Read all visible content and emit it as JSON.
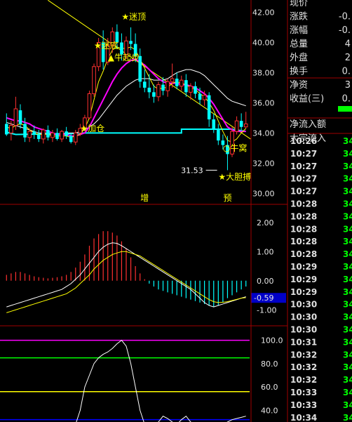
{
  "chart_data": [
    {
      "type": "candlestick",
      "title": "",
      "ylim": [
        29.5,
        43
      ],
      "yticks": [
        "42.00",
        "40.00",
        "38.00",
        "36.00",
        "34.00",
        "32.00",
        "30.00"
      ],
      "ytick_values": [
        42,
        40,
        38,
        36,
        34,
        32,
        30
      ],
      "candles": [
        {
          "o": 34.6,
          "h": 35.3,
          "l": 33.8,
          "c": 33.9
        },
        {
          "o": 34.0,
          "h": 34.8,
          "l": 33.5,
          "c": 34.5
        },
        {
          "o": 34.5,
          "h": 36.4,
          "l": 34.2,
          "c": 35.6
        },
        {
          "o": 35.5,
          "h": 35.9,
          "l": 34.3,
          "c": 34.6
        },
        {
          "o": 34.6,
          "h": 35.0,
          "l": 33.4,
          "c": 33.7
        },
        {
          "o": 33.7,
          "h": 34.3,
          "l": 33.4,
          "c": 34.1
        },
        {
          "o": 34.1,
          "h": 34.5,
          "l": 33.6,
          "c": 33.9
        },
        {
          "o": 33.9,
          "h": 34.2,
          "l": 33.4,
          "c": 33.6
        },
        {
          "o": 33.6,
          "h": 34.3,
          "l": 33.3,
          "c": 34.2
        },
        {
          "o": 34.2,
          "h": 34.5,
          "l": 33.5,
          "c": 33.7
        },
        {
          "o": 33.7,
          "h": 34.2,
          "l": 33.4,
          "c": 34.0
        },
        {
          "o": 34.0,
          "h": 34.3,
          "l": 33.5,
          "c": 33.6
        },
        {
          "o": 33.6,
          "h": 34.2,
          "l": 33.4,
          "c": 34.1
        },
        {
          "o": 34.1,
          "h": 34.4,
          "l": 33.6,
          "c": 33.8
        },
        {
          "o": 33.8,
          "h": 34.0,
          "l": 33.3,
          "c": 33.4
        },
        {
          "o": 33.4,
          "h": 34.2,
          "l": 33.2,
          "c": 34.0
        },
        {
          "o": 34.0,
          "h": 34.6,
          "l": 33.8,
          "c": 34.3
        },
        {
          "o": 34.3,
          "h": 35.2,
          "l": 34.1,
          "c": 35.0
        },
        {
          "o": 35.0,
          "h": 36.8,
          "l": 34.9,
          "c": 36.6
        },
        {
          "o": 36.6,
          "h": 38.6,
          "l": 36.4,
          "c": 38.4
        },
        {
          "o": 38.4,
          "h": 40.3,
          "l": 38.1,
          "c": 40.0
        },
        {
          "o": 40.0,
          "h": 40.8,
          "l": 38.2,
          "c": 38.7
        },
        {
          "o": 38.7,
          "h": 40.3,
          "l": 38.5,
          "c": 39.8
        },
        {
          "o": 39.8,
          "h": 41.0,
          "l": 39.3,
          "c": 40.7
        },
        {
          "o": 40.7,
          "h": 41.2,
          "l": 39.6,
          "c": 40.0
        },
        {
          "o": 40.0,
          "h": 40.6,
          "l": 38.8,
          "c": 39.2
        },
        {
          "o": 39.2,
          "h": 40.4,
          "l": 38.9,
          "c": 40.1
        },
        {
          "o": 40.1,
          "h": 41.0,
          "l": 39.5,
          "c": 39.9
        },
        {
          "o": 39.9,
          "h": 40.6,
          "l": 38.7,
          "c": 39.1
        },
        {
          "o": 39.1,
          "h": 39.6,
          "l": 37.0,
          "c": 37.4
        },
        {
          "o": 37.4,
          "h": 38.2,
          "l": 36.7,
          "c": 37.0
        },
        {
          "o": 37.0,
          "h": 37.9,
          "l": 36.3,
          "c": 36.7
        },
        {
          "o": 36.7,
          "h": 37.2,
          "l": 36.0,
          "c": 36.4
        },
        {
          "o": 36.4,
          "h": 37.4,
          "l": 36.1,
          "c": 37.2
        },
        {
          "o": 37.2,
          "h": 37.7,
          "l": 36.5,
          "c": 36.8
        },
        {
          "o": 36.8,
          "h": 37.6,
          "l": 36.4,
          "c": 37.4
        },
        {
          "o": 37.4,
          "h": 38.6,
          "l": 37.0,
          "c": 37.6
        },
        {
          "o": 37.6,
          "h": 38.0,
          "l": 36.9,
          "c": 37.1
        },
        {
          "o": 37.1,
          "h": 37.8,
          "l": 36.8,
          "c": 37.5
        },
        {
          "o": 37.5,
          "h": 37.9,
          "l": 36.4,
          "c": 36.7
        },
        {
          "o": 36.7,
          "h": 37.3,
          "l": 36.2,
          "c": 37.1
        },
        {
          "o": 37.1,
          "h": 37.4,
          "l": 36.3,
          "c": 36.6
        },
        {
          "o": 36.6,
          "h": 37.0,
          "l": 35.9,
          "c": 36.2
        },
        {
          "o": 36.2,
          "h": 36.8,
          "l": 35.8,
          "c": 36.5
        },
        {
          "o": 36.5,
          "h": 36.7,
          "l": 34.4,
          "c": 34.9
        },
        {
          "o": 34.9,
          "h": 35.3,
          "l": 34.0,
          "c": 34.2
        },
        {
          "o": 34.2,
          "h": 34.6,
          "l": 33.2,
          "c": 33.5
        },
        {
          "o": 33.5,
          "h": 33.9,
          "l": 32.9,
          "c": 33.2
        },
        {
          "o": 33.2,
          "h": 33.8,
          "l": 31.53,
          "c": 32.6
        },
        {
          "o": 32.6,
          "h": 34.4,
          "l": 32.4,
          "c": 34.1
        },
        {
          "o": 34.1,
          "h": 35.1,
          "l": 33.9,
          "c": 34.8
        },
        {
          "o": 34.8,
          "h": 35.3,
          "l": 34.2,
          "c": 34.4
        },
        {
          "o": 34.4,
          "h": 35.4,
          "l": 34.3,
          "c": 34.6
        }
      ],
      "ma_yellow": [
        34.4,
        34.3,
        34.5,
        34.6,
        34.5,
        34.2,
        34.0,
        33.9,
        33.9,
        33.9,
        33.8,
        33.8,
        33.8,
        33.8,
        33.7,
        33.8,
        33.9,
        34.3,
        35.0,
        36.2,
        37.4,
        38.1,
        38.9,
        39.5,
        39.7,
        39.6,
        39.6,
        39.7,
        39.5,
        38.9,
        38.3,
        37.7,
        37.1,
        36.9,
        37.0,
        37.0,
        37.3,
        37.4,
        37.3,
        37.2,
        37.0,
        36.9,
        36.6,
        36.4,
        36.0,
        35.5,
        34.8,
        34.1,
        33.5,
        33.4,
        33.6,
        34.0,
        34.3
      ],
      "ma_magenta": [
        35.0,
        34.9,
        34.8,
        34.8,
        34.7,
        34.6,
        34.4,
        34.3,
        34.2,
        34.1,
        34.0,
        33.9,
        33.9,
        33.9,
        33.8,
        33.8,
        33.9,
        34.0,
        34.4,
        35.0,
        35.6,
        36.2,
        36.8,
        37.4,
        37.9,
        38.3,
        38.6,
        38.8,
        38.9,
        38.7,
        38.5,
        38.2,
        37.9,
        37.6,
        37.4,
        37.3,
        37.3,
        37.3,
        37.2,
        37.2,
        37.1,
        37.0,
        36.8,
        36.6,
        36.3,
        35.9,
        35.4,
        34.9,
        34.4,
        34.2,
        34.1,
        34.1,
        34.1
      ],
      "ma_white": [
        34.7,
        34.6,
        34.5,
        34.4,
        34.3,
        34.2,
        34.1,
        34.0,
        34.0,
        34.0,
        33.9,
        33.9,
        33.9,
        34.0,
        34.0,
        34.0,
        34.1,
        34.2,
        34.4,
        34.6,
        34.9,
        35.3,
        35.7,
        36.1,
        36.5,
        36.8,
        37.1,
        37.3,
        37.5,
        37.6,
        37.6,
        37.6,
        37.5,
        37.5,
        37.5,
        37.6,
        37.8,
        38.0,
        38.1,
        38.2,
        38.2,
        38.1,
        38.0,
        37.8,
        37.5,
        37.2,
        36.9,
        36.6,
        36.3,
        36.1,
        36.0,
        35.9,
        35.8
      ],
      "cyan_step": [
        [
          0,
          34.05
        ],
        [
          2,
          33.9
        ],
        [
          14,
          33.95
        ],
        [
          16,
          34.0
        ],
        [
          26,
          34.0
        ],
        [
          38,
          34.0
        ],
        [
          38,
          34.25
        ],
        [
          48,
          34.25
        ],
        [
          49,
          34.25
        ],
        [
          52,
          34.1
        ]
      ],
      "trendline": {
        "from": [
          9,
          42.8
        ],
        "to": [
          53,
          33.6
        ]
      },
      "annotations": [
        {
          "label": "迷顶",
          "i": 25,
          "y": 41.5
        },
        {
          "label": "迷底",
          "i": 19,
          "y": 39.6
        },
        {
          "label": "牛起步",
          "i": 22,
          "y": 38.8
        },
        {
          "label": "加仓",
          "i": 16,
          "y": 34.1
        },
        {
          "label": "牛窝",
          "i": 47,
          "y": 33.0
        },
        {
          "label": "31.53",
          "i": 43,
          "y": 31.53
        },
        {
          "label": "大胆搏",
          "i": 46,
          "y": 30.9
        }
      ],
      "markers": [
        {
          "label": "增",
          "i": 30
        },
        {
          "label": "预",
          "i": 48
        }
      ]
    },
    {
      "type": "macd",
      "title": "",
      "ylim": [
        -1.5,
        2.5
      ],
      "yticks": [
        "2.00",
        "1.00",
        "0.00",
        "-1.00"
      ],
      "ytick_values": [
        2,
        1,
        0,
        -1
      ],
      "current_value": "-0.59",
      "bars": [
        0.2,
        0.25,
        0.3,
        0.3,
        0.25,
        0.2,
        0.15,
        0.12,
        0.1,
        0.08,
        0.1,
        0.12,
        0.15,
        0.2,
        0.3,
        0.45,
        0.65,
        0.9,
        1.2,
        1.45,
        1.6,
        1.7,
        1.7,
        1.65,
        1.55,
        1.35,
        1.1,
        0.8,
        0.5,
        0.25,
        0.05,
        -0.1,
        -0.2,
        -0.3,
        -0.35,
        -0.4,
        -0.45,
        -0.5,
        -0.55,
        -0.6,
        -0.65,
        -0.7,
        -0.75,
        -0.8,
        -0.85,
        -0.9,
        -0.85,
        -0.75,
        -0.6,
        -0.5,
        -0.4,
        -0.3,
        -0.2
      ],
      "dif": [
        -0.9,
        -0.85,
        -0.8,
        -0.75,
        -0.7,
        -0.65,
        -0.6,
        -0.55,
        -0.5,
        -0.45,
        -0.4,
        -0.35,
        -0.3,
        -0.2,
        -0.1,
        0.05,
        0.2,
        0.4,
        0.6,
        0.8,
        1.0,
        1.15,
        1.25,
        1.3,
        1.28,
        1.2,
        1.1,
        1.0,
        0.9,
        0.8,
        0.7,
        0.6,
        0.5,
        0.4,
        0.3,
        0.2,
        0.1,
        0.0,
        -0.1,
        -0.2,
        -0.3,
        -0.45,
        -0.6,
        -0.75,
        -0.85,
        -0.9,
        -0.85,
        -0.8,
        -0.75,
        -0.7,
        -0.65,
        -0.6,
        -0.55
      ],
      "dea": [
        -1.1,
        -1.05,
        -1.0,
        -0.95,
        -0.9,
        -0.85,
        -0.8,
        -0.75,
        -0.7,
        -0.65,
        -0.6,
        -0.55,
        -0.5,
        -0.45,
        -0.35,
        -0.25,
        -0.1,
        0.05,
        0.2,
        0.4,
        0.55,
        0.7,
        0.8,
        0.9,
        0.95,
        1.0,
        1.0,
        0.95,
        0.9,
        0.85,
        0.75,
        0.65,
        0.55,
        0.45,
        0.35,
        0.25,
        0.15,
        0.05,
        -0.05,
        -0.15,
        -0.25,
        -0.35,
        -0.45,
        -0.55,
        -0.65,
        -0.72,
        -0.75,
        -0.74,
        -0.72,
        -0.68,
        -0.64,
        -0.6,
        -0.58
      ]
    },
    {
      "type": "line",
      "title": "",
      "ylim": [
        30,
        110
      ],
      "yticks": [
        "100.0",
        "80.0",
        "60.0",
        "40.0"
      ],
      "ytick_values": [
        100,
        80,
        60,
        40
      ],
      "hlines": [
        {
          "y": 100,
          "color": "#ff00ff"
        },
        {
          "y": 85,
          "color": "#00ff00"
        },
        {
          "y": 56,
          "color": "#ffff00"
        },
        {
          "y": 32,
          "color": "#0000ff"
        }
      ],
      "values": [
        null,
        null,
        null,
        null,
        null,
        null,
        null,
        null,
        null,
        null,
        null,
        null,
        null,
        null,
        null,
        20,
        40,
        60,
        70,
        80,
        85,
        88,
        90,
        93,
        97,
        100,
        95,
        80,
        60,
        40,
        25,
        18,
        22,
        30,
        35,
        33,
        30,
        28,
        32,
        35,
        30,
        28,
        25,
        22,
        20,
        22,
        25,
        28,
        30,
        32,
        33,
        34,
        35
      ]
    }
  ],
  "right_panel": {
    "quote_rows": [
      {
        "label": "现价",
        "value": ""
      },
      {
        "label": "涨跌",
        "value": "-0."
      },
      {
        "label": "涨幅",
        "value": "-0."
      },
      {
        "label": "总量",
        "value": "4"
      },
      {
        "label": "外盘",
        "value": "2"
      },
      {
        "label": "换手",
        "value": "0."
      },
      {
        "label": "净资",
        "value": "3"
      },
      {
        "label": "收益(三)",
        "value": "0."
      }
    ],
    "flow_rows": [
      {
        "label": "净流入额"
      },
      {
        "label": "大宗流入"
      }
    ],
    "ticks": [
      {
        "time": "10:26",
        "val": "34"
      },
      {
        "time": "10:27",
        "val": "34"
      },
      {
        "time": "10:27",
        "val": "34"
      },
      {
        "time": "10:27",
        "val": "34"
      },
      {
        "time": "10:27",
        "val": "34"
      },
      {
        "time": "10:28",
        "val": "34"
      },
      {
        "time": "10:28",
        "val": "34"
      },
      {
        "time": "10:28",
        "val": "34"
      },
      {
        "time": "10:28",
        "val": "34"
      },
      {
        "time": "10:28",
        "val": "34"
      },
      {
        "time": "10:29",
        "val": "34"
      },
      {
        "time": "10:29",
        "val": "34"
      },
      {
        "time": "10:29",
        "val": "34"
      },
      {
        "time": "10:30",
        "val": "34"
      },
      {
        "time": "10:30",
        "val": "34"
      },
      {
        "time": "10:30",
        "val": "34"
      },
      {
        "time": "10:31",
        "val": "34"
      },
      {
        "time": "10:32",
        "val": "34"
      },
      {
        "time": "10:32",
        "val": "34"
      },
      {
        "time": "10:32",
        "val": "34"
      },
      {
        "time": "10:33",
        "val": "34"
      },
      {
        "time": "10:33",
        "val": "34"
      },
      {
        "time": "10:34",
        "val": "34"
      }
    ]
  },
  "colors": {
    "up": "#ff3030",
    "down": "#00ffff",
    "ma_yellow": "#ffff00",
    "ma_magenta": "#ff00ff",
    "ma_white": "#ffffff",
    "cyan_line": "#00ffff",
    "trend": "#ffff00",
    "divider": "#a00000",
    "grid_text": "#e6e6e6",
    "green": "#00ff00"
  }
}
